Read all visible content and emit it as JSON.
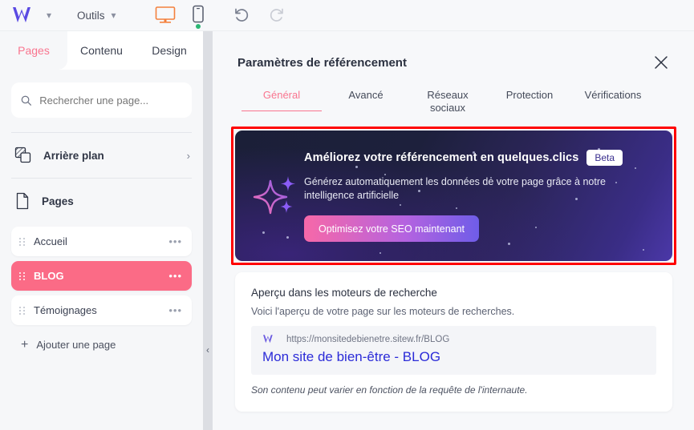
{
  "topbar": {
    "logo_icon": "sitew-w-logo-icon",
    "logo_caret_icon": "chevron-down-icon",
    "tools_label": "Outils",
    "tools_caret_icon": "chevron-down-icon",
    "desktop_icon": "desktop-preview-icon",
    "mobile_icon": "mobile-preview-icon",
    "mobile_status_dot": "online-dot",
    "undo_icon": "undo-icon",
    "redo_icon": "redo-icon"
  },
  "sidebar": {
    "tabs": [
      {
        "label": "Pages",
        "active": true
      },
      {
        "label": "Contenu",
        "active": false
      },
      {
        "label": "Design",
        "active": false
      }
    ],
    "search": {
      "icon": "search-icon",
      "placeholder": "Rechercher une page...",
      "value": ""
    },
    "background_row": {
      "icon": "layers-background-icon",
      "label": "Arrière plan",
      "chevron": "chevron-right-icon"
    },
    "pages_row": {
      "icon": "page-document-icon",
      "label": "Pages"
    },
    "pages": [
      {
        "label": "Accueil",
        "selected": false,
        "grip_icon": "drag-handle-icon",
        "menu_icon": "more-options-icon"
      },
      {
        "label": "BLOG",
        "selected": true,
        "grip_icon": "drag-handle-icon",
        "menu_icon": "more-options-icon"
      },
      {
        "label": "Témoignages",
        "selected": false,
        "grip_icon": "drag-handle-icon",
        "menu_icon": "more-options-icon"
      }
    ],
    "add_page": {
      "icon": "plus-icon",
      "label": "Ajouter une page"
    },
    "collapse_handle_icon": "chevron-left-icon"
  },
  "panel": {
    "title": "Paramètres de référencement",
    "close_icon": "close-icon",
    "tabs": [
      {
        "label": "Général",
        "active": true
      },
      {
        "label": "Avancé",
        "active": false
      },
      {
        "label": "Réseaux\nsociaux",
        "line1": "Réseaux",
        "line2": "sociaux",
        "active": false
      },
      {
        "label": "Protection",
        "active": false
      },
      {
        "label": "Vérifications",
        "active": false
      }
    ]
  },
  "banner": {
    "highlight_color": "#ff0000",
    "sparkle_icon": "ai-sparkle-icon",
    "title": "Améliorez votre référencement en quelques.clics",
    "badge": "Beta",
    "subtitle": "Générez automatiquement les données de votre page grâce à notre intelligence artificielle",
    "cta_label": "Optimisez votre SEO maintenant",
    "gradient_start": "#1b1f38",
    "gradient_end": "#4b38a8",
    "cta_gradient_start": "#f768a8",
    "cta_gradient_end": "#6f5de8"
  },
  "preview_card": {
    "title": "Aperçu dans les moteurs de recherche",
    "subtitle": "Voici l'aperçu de votre page sur les moteurs de recherches.",
    "serp": {
      "favicon": "sitew-w-logo-icon",
      "url": "https://monsitedebienetre.sitew.fr/BLOG",
      "title": "Mon site de bien-être - BLOG",
      "title_color": "#2b2bd8"
    },
    "note": "Son contenu peut varier en fonction de la requête de l'internaute."
  }
}
